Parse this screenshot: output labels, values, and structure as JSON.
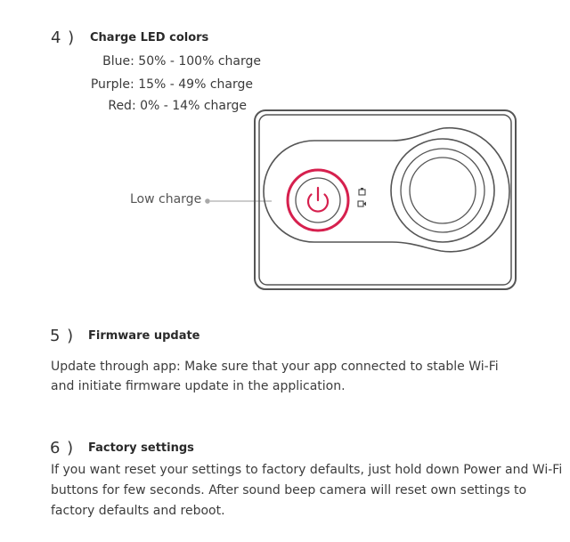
{
  "section4": {
    "number": "4 )",
    "title": "Charge LED colors",
    "led_lines": [
      "Blue:  50% - 100% charge",
      "Purple:  15% - 49% charge",
      "Red:  0% - 14% charge"
    ],
    "callout_label": "Low charge"
  },
  "section5": {
    "number": "5 )",
    "title": "Firmware update",
    "lines": [
      "Update through app: Make sure that your app connected to stable Wi-Fi",
      "and initiate firmware update in the application."
    ]
  },
  "section6": {
    "number": "6 )",
    "title": "Factory settings",
    "lines": [
      "If you want reset your settings to factory defaults, just hold down Power and Wi-Fi",
      "buttons for few seconds. After sound beep camera will reset own settings to",
      "factory defaults and reboot."
    ]
  },
  "colors": {
    "power_ring": "#d6204e",
    "outline": "#555555"
  },
  "icons": [
    "power-icon",
    "camera-mode-icon",
    "video-mode-icon",
    "lens-icon"
  ]
}
